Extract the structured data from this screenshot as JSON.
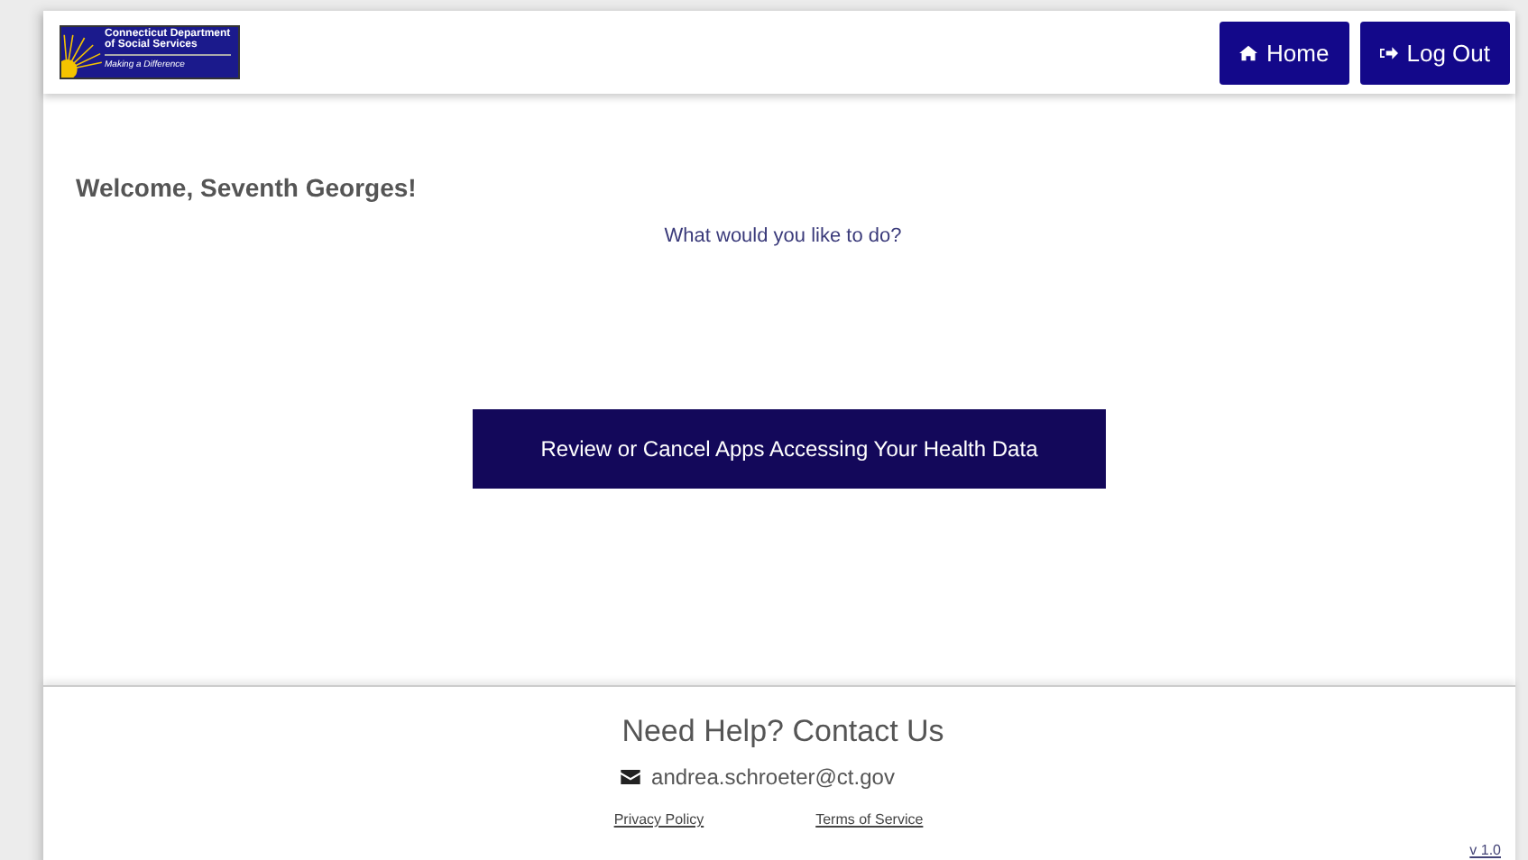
{
  "header": {
    "logo": {
      "line_1": "Connecticut Department",
      "line_2": "of Social Services",
      "tagline": "Making a Difference"
    },
    "buttons": [
      {
        "kind": "home",
        "label": "Home"
      },
      {
        "kind": "logout",
        "label": "Log Out"
      }
    ]
  },
  "main": {
    "welcome": "Welcome,  Seventh Georges!",
    "question": "What would you like to do?",
    "action": "Review or Cancel Apps Accessing Your Health Data"
  },
  "footer": {
    "heading": "Need Help? Contact Us",
    "email": "andrea.schroeter@ct.gov",
    "links": [
      "Privacy Policy",
      "Terms of Service"
    ],
    "version": "v 1.0"
  }
}
